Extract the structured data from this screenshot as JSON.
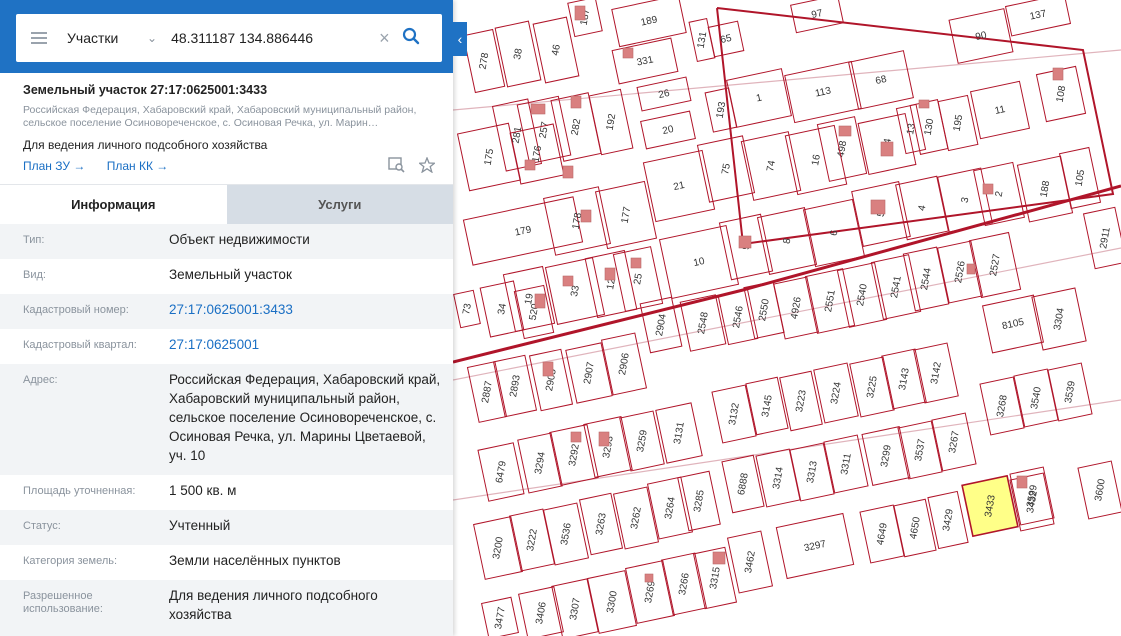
{
  "search": {
    "type_label": "Участки",
    "query": "48.311187 134.886446"
  },
  "card": {
    "title": "Земельный участок 27:17:0625001:3433",
    "address": "Российская Федерация, Хабаровский край, Хабаровский муниципальный район, сельское поселение Осиновореченское, с. Осиновая Речка, ул. Марин…",
    "use": "Для ведения личного подсобного хозяйства",
    "link_zu": "План ЗУ →",
    "link_kk": "План КК →"
  },
  "tabs": {
    "info": "Информация",
    "services": "Услуги"
  },
  "info_rows": [
    {
      "key": "Тип:",
      "value": "Объект недвижимости"
    },
    {
      "key": "Вид:",
      "value": "Земельный участок"
    },
    {
      "key": "Кадастровый номер:",
      "value": "27:17:0625001:3433"
    },
    {
      "key": "Кадастровый квартал:",
      "value": "27:17:0625001"
    },
    {
      "key": "Адрес:",
      "value": "Российская Федерация, Хабаровский край, Хабаровский муниципальный район, сельское поселение Осиновореченское, с. Осиновая Речка, ул. Марины Цветаевой, уч. 10"
    },
    {
      "key": "Площадь уточненная:",
      "value": "1 500 кв. м"
    },
    {
      "key": "Статус:",
      "value": "Учтенный"
    },
    {
      "key": "Категория земель:",
      "value": "Земли населённых пунктов"
    },
    {
      "key": "Разрешенное использование:",
      "value": "Для ведения личного подсобного хозяйства"
    }
  ],
  "map": {
    "selected_parcel": "3433",
    "parcel_labels": [
      "187",
      "189",
      "97",
      "137",
      "278",
      "38",
      "46",
      "331",
      "65",
      "90",
      "131",
      "113",
      "68",
      "1",
      "26",
      "193",
      "108",
      "11",
      "175",
      "281",
      "257",
      "282",
      "192",
      "20",
      "498",
      "14",
      "13",
      "130",
      "195",
      "105",
      "176",
      "21",
      "75",
      "74",
      "16",
      "188",
      "179",
      "178",
      "177",
      "5",
      "4",
      "3",
      "2",
      "2911",
      "10",
      "9",
      "8",
      "6",
      "19",
      "34",
      "33",
      "12",
      "25",
      "73",
      "520",
      "2904",
      "2548",
      "2546",
      "2550",
      "4926",
      "2551",
      "2540",
      "2541",
      "2544",
      "2526",
      "2527",
      "8105",
      "3304",
      "2887",
      "2893",
      "2905",
      "2907",
      "2906",
      "3132",
      "3145",
      "3223",
      "3224",
      "3225",
      "3143",
      "3142",
      "3268",
      "3540",
      "3539",
      "6479",
      "3294",
      "3292",
      "3293",
      "3259",
      "3131",
      "6888",
      "3314",
      "3313",
      "3311",
      "3299",
      "3537",
      "3267",
      "3599",
      "3600",
      "3200",
      "3222",
      "3536",
      "3263",
      "3262",
      "3264",
      "3285",
      "3462",
      "3297",
      "4649",
      "4650",
      "3429",
      "3433",
      "3432",
      "3269",
      "3266",
      "3315",
      "3406",
      "3307",
      "3300",
      "3477"
    ],
    "colors": {
      "parcel_border": "#b0152a",
      "building": "#d98080",
      "selected_fill": "#ffff88",
      "road": "#e0b4bc"
    }
  }
}
